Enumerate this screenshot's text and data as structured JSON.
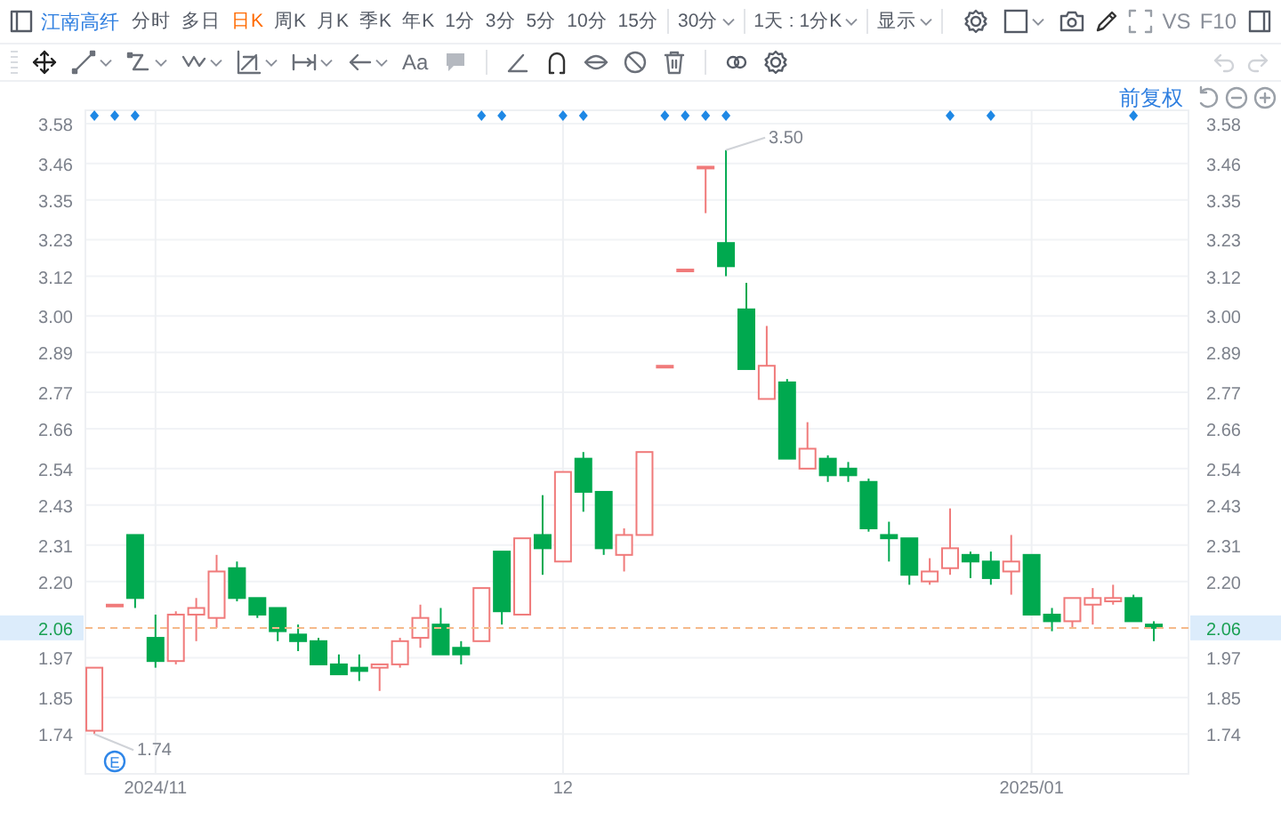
{
  "toolbar": {
    "stock_name": "江南高纤",
    "periods": [
      {
        "label": "分时",
        "kind": "tab",
        "selected": false
      },
      {
        "label": "多日",
        "kind": "tab",
        "selected": false
      },
      {
        "label": "日K",
        "kind": "tab",
        "selected": true
      },
      {
        "label": "周K",
        "kind": "tab",
        "selected": false
      },
      {
        "label": "月K",
        "kind": "tab",
        "selected": false
      },
      {
        "label": "季K",
        "kind": "tab",
        "selected": false
      },
      {
        "label": "年K",
        "kind": "tab",
        "selected": false
      },
      {
        "label": "1分",
        "kind": "tab",
        "selected": false
      },
      {
        "label": "3分",
        "kind": "tab",
        "selected": false
      },
      {
        "label": "5分",
        "kind": "tab",
        "selected": false
      },
      {
        "label": "10分",
        "kind": "tab",
        "selected": false
      },
      {
        "label": "15分",
        "kind": "tab",
        "selected": false
      },
      {
        "label": "30分",
        "kind": "menu",
        "selected": false
      },
      {
        "label": "1天 : 1分K",
        "kind": "menu",
        "selected": false
      },
      {
        "label": "显示",
        "kind": "menu",
        "selected": false
      }
    ],
    "compare_label": "VS",
    "f10_label": "F10"
  },
  "drawing_toolbar": {
    "text_tool_label": "Aa"
  },
  "chart": {
    "adjust_label": "前复权",
    "event_badge": "E",
    "left_axis_labels": [
      "3.58",
      "3.46",
      "3.35",
      "3.23",
      "3.12",
      "3.00",
      "2.89",
      "2.77",
      "2.66",
      "2.54",
      "2.43",
      "2.31",
      "2.20",
      "1.97",
      "1.85",
      "1.74"
    ],
    "high_label": "3.50",
    "low_label": "1.74",
    "price_tags": [
      "2.06",
      "2.06"
    ],
    "event_marks": [
      true,
      true,
      true,
      false,
      false,
      false,
      false,
      false,
      false,
      false,
      false,
      false,
      false,
      false,
      false,
      false,
      false,
      false,
      false,
      true,
      true,
      false,
      false,
      true,
      true,
      false,
      false,
      false,
      true,
      true,
      true,
      true,
      false,
      false,
      false,
      false,
      false,
      false,
      false,
      false,
      false,
      false,
      true,
      false,
      true,
      false,
      false,
      false,
      false,
      false,
      false,
      true,
      false
    ],
    "chart_data": {
      "type": "candlestick",
      "grid": true,
      "categories": [
        null,
        null,
        null,
        "2024/11",
        null,
        null,
        null,
        null,
        null,
        null,
        null,
        null,
        null,
        null,
        null,
        null,
        null,
        null,
        null,
        null,
        null,
        null,
        null,
        "12",
        null,
        null,
        null,
        null,
        null,
        null,
        null,
        null,
        null,
        null,
        null,
        null,
        null,
        null,
        null,
        null,
        null,
        null,
        null,
        null,
        null,
        null,
        "2025/01",
        null,
        null,
        null,
        null,
        null,
        null
      ],
      "ylim": [
        1.62,
        3.62
      ],
      "yticks": [
        {
          "value": 3.58,
          "label": "3.58"
        },
        {
          "value": 3.46,
          "label": "3.46"
        },
        {
          "value": 3.35,
          "label": "3.35"
        },
        {
          "value": 3.23,
          "label": "3.23"
        },
        {
          "value": 3.12,
          "label": "3.12"
        },
        {
          "value": 3.0,
          "label": "3.00"
        },
        {
          "value": 2.89,
          "label": "2.89"
        },
        {
          "value": 2.77,
          "label": "2.77"
        },
        {
          "value": 2.66,
          "label": "2.66"
        },
        {
          "value": 2.54,
          "label": "2.54"
        },
        {
          "value": 2.43,
          "label": "2.43"
        },
        {
          "value": 2.31,
          "label": "2.31"
        },
        {
          "value": 2.2,
          "label": "2.20"
        },
        {
          "value": 1.97,
          "label": "1.97"
        },
        {
          "value": 1.85,
          "label": "1.85"
        },
        {
          "value": 1.74,
          "label": "1.74"
        }
      ],
      "ohlc": [
        [
          1.75,
          1.94,
          1.74,
          1.94
        ],
        [
          2.13,
          2.13,
          2.13,
          2.13
        ],
        [
          2.34,
          2.34,
          2.12,
          2.15
        ],
        [
          2.03,
          2.1,
          1.94,
          1.96
        ],
        [
          1.96,
          2.11,
          1.95,
          2.1
        ],
        [
          2.1,
          2.15,
          2.02,
          2.12
        ],
        [
          2.09,
          2.28,
          2.06,
          2.23
        ],
        [
          2.24,
          2.26,
          2.14,
          2.15
        ],
        [
          2.15,
          2.15,
          2.09,
          2.1
        ],
        [
          2.12,
          2.12,
          2.02,
          2.05
        ],
        [
          2.04,
          2.07,
          1.99,
          2.02
        ],
        [
          2.02,
          2.03,
          1.95,
          1.95
        ],
        [
          1.95,
          1.98,
          1.92,
          1.92
        ],
        [
          1.94,
          1.98,
          1.9,
          1.93
        ],
        [
          1.94,
          1.95,
          1.87,
          1.95
        ],
        [
          1.95,
          2.03,
          1.94,
          2.02
        ],
        [
          2.03,
          2.13,
          2.0,
          2.09
        ],
        [
          2.07,
          2.12,
          1.98,
          1.98
        ],
        [
          2.0,
          2.02,
          1.95,
          1.98
        ],
        [
          2.02,
          2.18,
          2.02,
          2.18
        ],
        [
          2.29,
          2.29,
          2.07,
          2.11
        ],
        [
          2.1,
          2.33,
          2.1,
          2.33
        ],
        [
          2.34,
          2.46,
          2.22,
          2.3
        ],
        [
          2.26,
          2.53,
          2.26,
          2.53
        ],
        [
          2.57,
          2.59,
          2.41,
          2.47
        ],
        [
          2.47,
          2.47,
          2.28,
          2.3
        ],
        [
          2.28,
          2.36,
          2.23,
          2.34
        ],
        [
          2.34,
          2.59,
          2.34,
          2.59
        ],
        [
          2.85,
          2.85,
          2.85,
          2.85
        ],
        [
          3.14,
          3.14,
          3.14,
          3.14
        ],
        [
          3.45,
          3.45,
          3.31,
          3.45
        ],
        [
          3.22,
          3.5,
          3.12,
          3.15
        ],
        [
          3.02,
          3.1,
          2.84,
          2.84
        ],
        [
          2.75,
          2.97,
          2.75,
          2.85
        ],
        [
          2.8,
          2.81,
          2.57,
          2.57
        ],
        [
          2.54,
          2.68,
          2.54,
          2.6
        ],
        [
          2.57,
          2.58,
          2.5,
          2.52
        ],
        [
          2.54,
          2.56,
          2.5,
          2.52
        ],
        [
          2.5,
          2.51,
          2.35,
          2.36
        ],
        [
          2.34,
          2.38,
          2.26,
          2.33
        ],
        [
          2.33,
          2.33,
          2.19,
          2.22
        ],
        [
          2.2,
          2.27,
          2.19,
          2.23
        ],
        [
          2.24,
          2.42,
          2.22,
          2.3
        ],
        [
          2.28,
          2.29,
          2.21,
          2.26
        ],
        [
          2.26,
          2.29,
          2.19,
          2.21
        ],
        [
          2.23,
          2.34,
          2.16,
          2.26
        ],
        [
          2.28,
          2.28,
          2.1,
          2.1
        ],
        [
          2.1,
          2.12,
          2.05,
          2.08
        ],
        [
          2.08,
          2.15,
          2.06,
          2.15
        ],
        [
          2.13,
          2.18,
          2.07,
          2.15
        ],
        [
          2.14,
          2.19,
          2.13,
          2.15
        ],
        [
          2.15,
          2.16,
          2.08,
          2.08
        ],
        [
          2.07,
          2.08,
          2.02,
          2.06
        ]
      ]
    }
  }
}
